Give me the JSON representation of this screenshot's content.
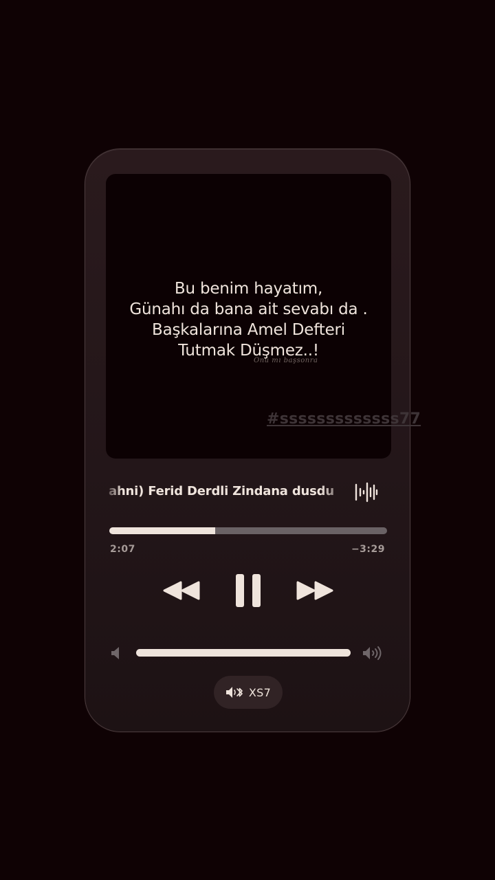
{
  "artwork": {
    "quote_lines": [
      "Bu benim hayatım,",
      "Günahı da bana ait sevabı da .",
      "Başkalarına Amel Defteri",
      "Tutmak Düşmez..!"
    ],
    "signature": "Onu mı başsonra",
    "hashtag": "#sssssssssssss77"
  },
  "track": {
    "title": "ahni) Ferid Derdli Zindana dusdu",
    "waveform_icon": "waveform-icon"
  },
  "playback": {
    "progress_fraction": 0.38,
    "elapsed": "2:07",
    "remaining": "−3:29"
  },
  "controls": {
    "rewind_icon": "rewind-icon",
    "pause_icon": "pause-icon",
    "forward_icon": "fast-forward-icon"
  },
  "volume": {
    "level_fraction": 1.0,
    "low_icon": "speaker-low-icon",
    "high_icon": "speaker-high-icon"
  },
  "output": {
    "icon": "speaker-bluetooth-icon",
    "device_label": "XS7"
  },
  "colors": {
    "background": "#0f0204",
    "card": "#241619",
    "foreground": "#efe4dc",
    "track_inactive": "#6a6265",
    "muted_text": "#a69b98"
  }
}
